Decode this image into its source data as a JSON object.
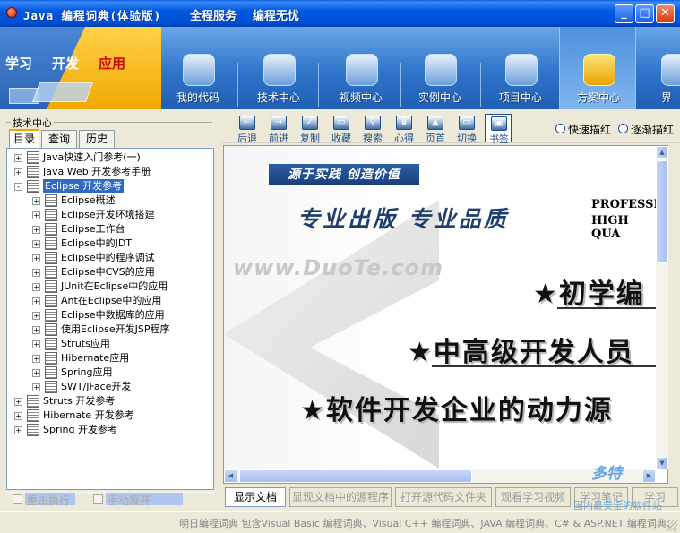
{
  "window": {
    "title": "Java 编程词典(体验版)",
    "slogan1": "全程服务",
    "slogan2": "编程无忧",
    "min": "_",
    "max": "□",
    "close": "✕"
  },
  "banner": {
    "logo_words": [
      "学习",
      "开发",
      "应用"
    ],
    "nav": [
      {
        "label": "我的代码",
        "icon": "user-icon"
      },
      {
        "label": "技术中心",
        "icon": "gears-icon"
      },
      {
        "label": "视频中心",
        "icon": "clapper-icon"
      },
      {
        "label": "实例中心",
        "icon": "monitors-icon"
      },
      {
        "label": "项目中心",
        "icon": "chart-icon"
      },
      {
        "label": "方案中心",
        "icon": "folder-icon",
        "active": true
      },
      {
        "label": "界",
        "icon": "globe-icon"
      }
    ]
  },
  "left": {
    "group": "技术中心",
    "tabs": [
      "目录",
      "查询",
      "历史"
    ],
    "tree": [
      {
        "label": "Java快速入门参考(一)",
        "level": 0,
        "expander": "+"
      },
      {
        "label": "Java Web 开发参考手册",
        "level": 0,
        "expander": "+"
      },
      {
        "label": "Eclipse 开发参考",
        "level": 0,
        "expander": "-",
        "selected": true
      },
      {
        "label": "Eclipse概述",
        "level": 1,
        "expander": "+"
      },
      {
        "label": "Eclipse开发环境搭建",
        "level": 1,
        "expander": "+"
      },
      {
        "label": "Eclipse工作台",
        "level": 1,
        "expander": "+"
      },
      {
        "label": "Eclipse中的JDT",
        "level": 1,
        "expander": "+"
      },
      {
        "label": "Eclipse中的程序调试",
        "level": 1,
        "expander": "+"
      },
      {
        "label": "Eclipse中CVS的应用",
        "level": 1,
        "expander": "+"
      },
      {
        "label": "JUnit在Eclipse中的应用",
        "level": 1,
        "expander": "+"
      },
      {
        "label": "Ant在Eclipse中的应用",
        "level": 1,
        "expander": "+"
      },
      {
        "label": "Eclipse中数据库的应用",
        "level": 1,
        "expander": "+"
      },
      {
        "label": "使用Eclipse开发JSP程序",
        "level": 1,
        "expander": "+"
      },
      {
        "label": "Struts应用",
        "level": 1,
        "expander": "+"
      },
      {
        "label": "Hibernate应用",
        "level": 1,
        "expander": "+"
      },
      {
        "label": "Spring应用",
        "level": 1,
        "expander": "+"
      },
      {
        "label": "SWT/JFace开发",
        "level": 1,
        "expander": "+"
      },
      {
        "label": "Struts 开发参考",
        "level": 0,
        "expander": "+"
      },
      {
        "label": "Hibernate 开发参考",
        "level": 0,
        "expander": "+"
      },
      {
        "label": "Spring 开发参考",
        "level": 0,
        "expander": "+"
      }
    ],
    "checkbox1": "重击执行",
    "checkbox2": "手动展开"
  },
  "toolbar": {
    "buttons": [
      {
        "label": "后退",
        "glyph": "←"
      },
      {
        "label": "前进",
        "glyph": "→"
      },
      {
        "label": "复制",
        "glyph": "✓"
      },
      {
        "label": "收藏",
        "glyph": "▭"
      },
      {
        "label": "搜索",
        "glyph": "⚲"
      },
      {
        "label": "心得",
        "glyph": "♛"
      },
      {
        "label": "页首",
        "glyph": "▲"
      },
      {
        "label": "切换",
        "glyph": "▭"
      },
      {
        "label": "书签",
        "glyph": "▣",
        "active": true
      }
    ],
    "radio1": "快速描红",
    "radio2": "逐渐描红"
  },
  "ad": {
    "tag": "源于实践  创造价值",
    "pro": "专业出版  专业品质",
    "prof1": "PROFESSI",
    "prof2": "HIGH QUA",
    "watermark": "www.DuoTe.com",
    "line1": "★初学编",
    "line2": "★中高级开发人员",
    "line3": "★软件开发企业的动力源"
  },
  "bottom_tabs": [
    "显示文档",
    "显现文档中的源程序",
    "打开源代码文件夹",
    "观看学习视频",
    "学习笔记",
    "学习"
  ],
  "status": "明日编程词典 包含Visual Basic 编程词典、Visual C++ 编程词典、JAVA 编程词典、C# & ASP.NET 编程词典、",
  "brand": "多特",
  "brand_sub": "国内最安全的软件站"
}
